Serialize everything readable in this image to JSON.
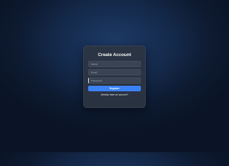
{
  "form": {
    "title": "Create Account",
    "fields": [
      {
        "placeholder": "Name",
        "value": ""
      },
      {
        "placeholder": "Email",
        "value": ""
      },
      {
        "placeholder": "Password",
        "value": ""
      }
    ],
    "register_label": "Register",
    "login_link": "Already have an account?"
  },
  "colors": {
    "accent": "#3b82f6",
    "card": "#2c3442",
    "field": "#3a4353",
    "background": "#0d1a30"
  }
}
